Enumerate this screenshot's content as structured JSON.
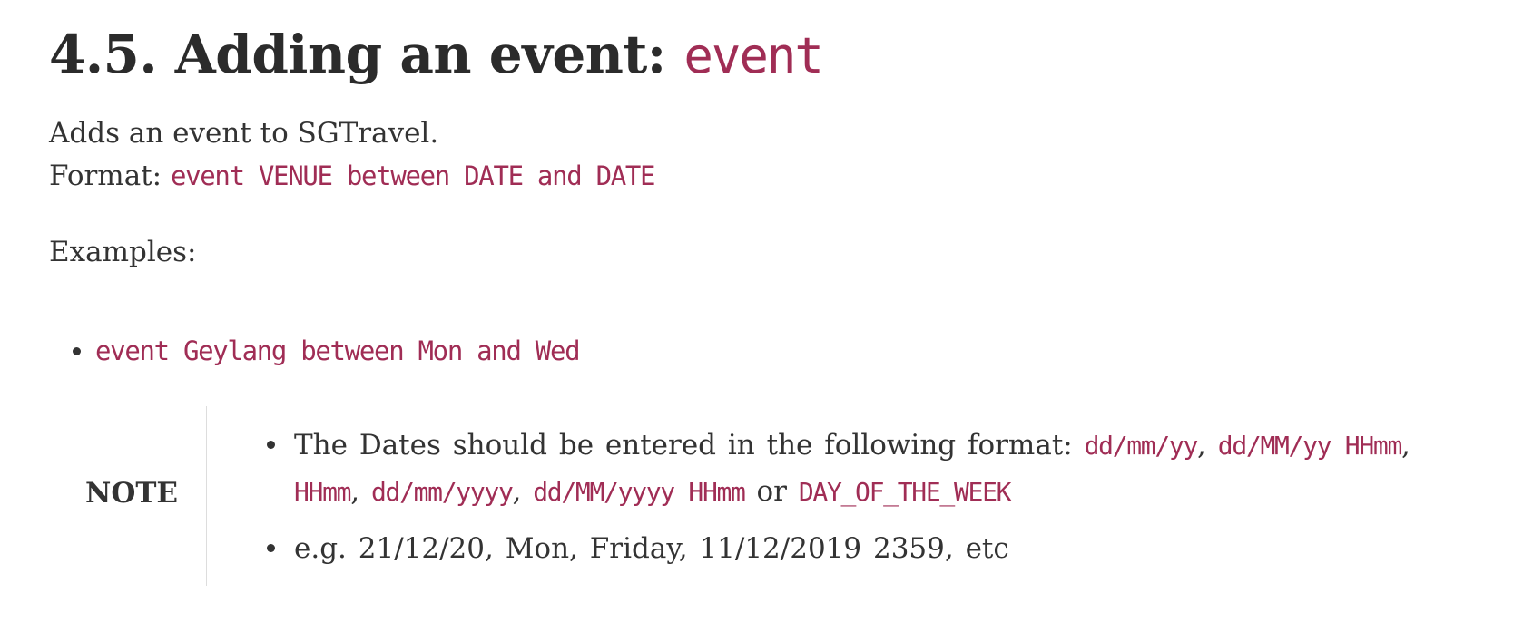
{
  "heading": {
    "text": "4.5. Adding an event: ",
    "code": "event"
  },
  "intro": {
    "description": "Adds an event to SGTravel.",
    "format_label": "Format: ",
    "format_code": "event VENUE between DATE and DATE"
  },
  "examples": {
    "label": "Examples:",
    "items": [
      "event Geylang between Mon and Wed"
    ]
  },
  "note": {
    "label": "NOTE",
    "item1": {
      "text_a": "The Dates should be entered in the following format: ",
      "code_1": "dd/mm/yy",
      "sep_1": ", ",
      "code_2": "dd/MM/yy HHmm",
      "sep_2": ", ",
      "code_3": "HHmm",
      "sep_3": ", ",
      "code_4": "dd/mm/yyyy",
      "sep_4": ", ",
      "code_5": "dd/MM/yyyy HHmm",
      "sep_5": " or ",
      "code_6": "DAY_OF_THE_WEEK"
    },
    "item2": "e.g. 21/12/20, Mon, Friday, 11/12/2019 2359, etc"
  },
  "colors": {
    "code": "#a02d55",
    "text": "#333333",
    "divider": "#dddddd"
  }
}
